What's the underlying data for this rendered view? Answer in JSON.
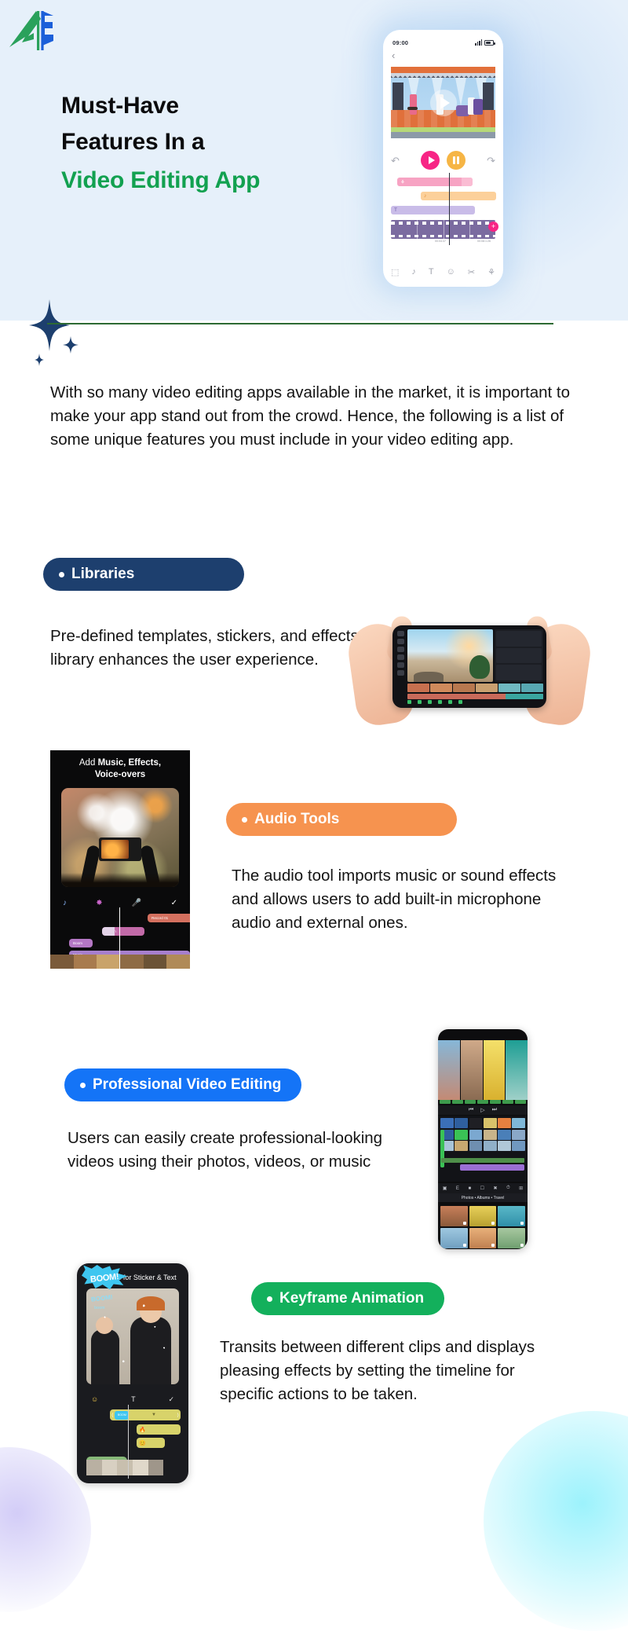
{
  "hero": {
    "logo_name": "ac-logo",
    "title_line1": "Must-Have",
    "title_line2": "Features In a",
    "title_line3": "Video Editing App",
    "accent_color": "#12a150",
    "bg_color": "#e6f0fa",
    "divider_color": "#2d6a33"
  },
  "hero_phone": {
    "status_time": "09:00",
    "back_icon": "‹",
    "undo_icon": "↶",
    "redo_icon": "↷",
    "play_label": "play-button",
    "pause_label": "pause-button",
    "tracks": [
      {
        "name": "sticker-track",
        "icon": "⚘",
        "color": "#f7a3c3"
      },
      {
        "name": "audio-track",
        "icon": "♪",
        "color": "#fcd09a"
      },
      {
        "name": "text-track",
        "icon": "T",
        "color": "#c9bce8"
      }
    ],
    "timecode_left": "00:04:37",
    "timecode_right": "00:08:1:26",
    "add_badge": "+",
    "toolbar": [
      "⬚",
      "♪",
      "T",
      "☺",
      "✂",
      "⚘"
    ]
  },
  "intro": {
    "paragraph": "With so many video editing apps available in the market, it is important to make your app stand out from the crowd. Hence, the following is a list of some unique features you must include in your video editing app."
  },
  "sections": [
    {
      "id": "libraries",
      "badge_label": "Libraries",
      "badge_color": "#1d3f6e",
      "body": "Pre-defined templates, stickers, and effects library enhances the user experience."
    },
    {
      "id": "audio",
      "badge_label": "Audio Tools",
      "badge_color": "#f6934f",
      "body": "The audio tool imports music or sound effects and allows users to add built-in microphone audio and external ones."
    },
    {
      "id": "pro",
      "badge_label": "Professional Video Editing",
      "badge_color": "#1474f7",
      "body": "Users can easily create professional-looking videos using their photos, videos, or music"
    },
    {
      "id": "keyframe",
      "badge_label": "Keyframe Animation",
      "badge_color": "#13b05c",
      "body": "Transits between different clips and displays pleasing effects by setting the timeline for specific actions to be taken."
    }
  ],
  "audio_phone": {
    "title_prefix": "Add ",
    "title_bold_line1": "Music, Effects,",
    "title_bold_line2": "Voice-overs",
    "tool_icons": [
      "♪",
      "✸",
      "Ἲ4",
      "✓"
    ],
    "tracks": [
      {
        "label": "Record 01",
        "color": "#d4705f"
      },
      {
        "label": "Laugh",
        "color": "#c26aa8"
      },
      {
        "label": "Boom",
        "color": "#b477c4"
      },
      {
        "label": "Music",
        "color": "#a77fcd"
      }
    ]
  },
  "pro_phone": {
    "gallery_tabs": "Photos • Albums • Travel",
    "transport_icons": [
      "⏮",
      "▷",
      "⏭"
    ]
  },
  "keyframe_phone": {
    "title_bold": "Keyframe",
    "title_rest": " for Sticker & Text",
    "sticker_label": "BOOM!",
    "sticker_label2": "BOOM!",
    "sticker_label3": "boom",
    "clip_chip": "BOOM",
    "tool_icons": [
      "☺",
      "T",
      "✓"
    ],
    "track_a_icon": "ὒ5",
    "track_b_icon": "ὠA",
    "clip_label": "Pillow Fight"
  },
  "decor": {
    "sparkle_color": "#1d3f6e",
    "blob_left_color": "#cec7f6",
    "blob_right_color": "#8bf0fc"
  }
}
